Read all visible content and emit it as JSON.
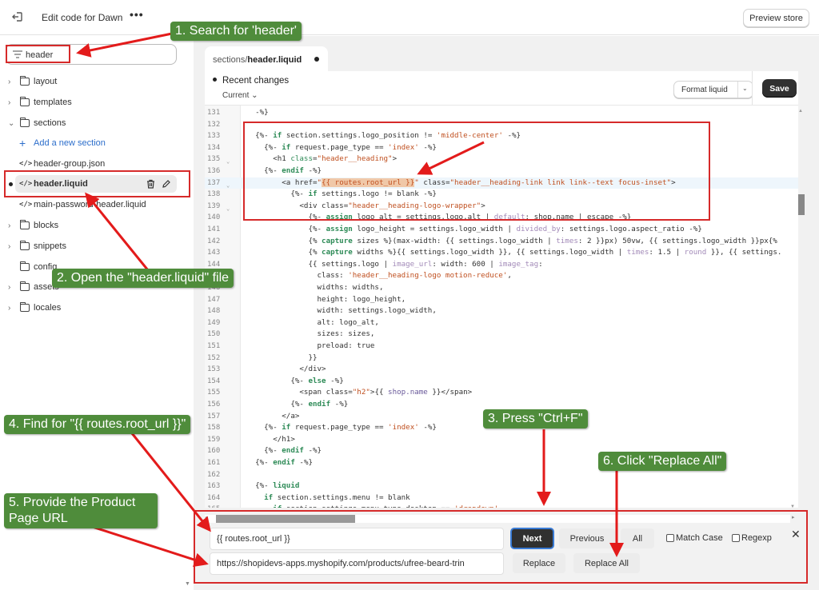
{
  "topbar": {
    "exit_icon": "exit-icon",
    "title": "Edit code for Dawn",
    "more_label": "•••",
    "preview_label": "Preview store"
  },
  "sidebar": {
    "search_value": "header",
    "search_icon": "filter-icon",
    "items": [
      {
        "type": "folder",
        "label": "layout",
        "expanded": false
      },
      {
        "type": "folder",
        "label": "templates",
        "expanded": false
      },
      {
        "type": "folder",
        "label": "sections",
        "expanded": true
      },
      {
        "type": "add",
        "label": "Add a new section"
      },
      {
        "type": "file",
        "label": "header-group.json"
      },
      {
        "type": "file",
        "label": "header.liquid",
        "active": true,
        "modified": true
      },
      {
        "type": "file",
        "label": "main-password-header.liquid"
      },
      {
        "type": "folder",
        "label": "blocks",
        "expanded": false
      },
      {
        "type": "folder",
        "label": "snippets",
        "expanded": false
      },
      {
        "type": "folder",
        "label": "config",
        "expanded": false
      },
      {
        "type": "folder",
        "label": "assets",
        "expanded": false
      },
      {
        "type": "folder",
        "label": "locales",
        "expanded": false
      }
    ]
  },
  "editor": {
    "tab_prefix": "sections/",
    "tab_file": "header.liquid",
    "recent_changes": "Recent changes",
    "current_label": "Current",
    "format_label": "Format liquid",
    "save_label": "Save",
    "lines": [
      {
        "n": "131",
        "html": "  -%}"
      },
      {
        "n": "132",
        "html": ""
      },
      {
        "n": "133",
        "html": "  <span class='p'>{%-</span> <span class='kw'>if</span> section.settings.logo_position != <span class='str'>'middle-center'</span> -%}"
      },
      {
        "n": "134",
        "html": "    {%- <span class='kw'>if</span> request.page_type == <span class='str'>'index'</span> -%}"
      },
      {
        "n": "135",
        "fold": true,
        "html": "      &lt;h1 <span class='kw2'>class</span>=<span class='str'>\"header__heading\"</span>&gt;"
      },
      {
        "n": "136",
        "html": "    {%- <span class='kw'>endif</span> -%}"
      },
      {
        "n": "137",
        "fold": true,
        "hl": true,
        "html": "        &lt;a href=<span class='str'>\"<span class='find-hl'>{{ routes.root_url }}</span>\"</span> class=<span class='str'>\"header__heading-link link link--text focus-inset\"</span>&gt;"
      },
      {
        "n": "138",
        "html": "          {%- <span class='kw'>if</span> settings.logo != blank -%}"
      },
      {
        "n": "139",
        "fold": true,
        "html": "            &lt;div class=<span class='str'>\"header__heading-logo-wrapper\"</span>&gt;"
      },
      {
        "n": "140",
        "html": "              {%- <span class='kw'>assign</span> logo_alt = settings.logo.alt | <span class='flt'>default</span>: shop.name | escape -%}"
      },
      {
        "n": "141",
        "html": "              {%- <span class='kw'>assign</span> logo_height = settings.logo_width | <span class='flt'>divided_by</span>: settings.logo.aspect_ratio -%}"
      },
      {
        "n": "142",
        "html": "              {% <span class='kw'>capture</span> sizes %}(max-width: {{ settings.logo_width | <span class='flt'>times</span>: 2 }}px) 50vw, {{ settings.logo_width }}px{%"
      },
      {
        "n": "143",
        "html": "              {% <span class='kw'>capture</span> widths %}{{ settings.logo_width }}, {{ settings.logo_width | <span class='flt'>times</span>: 1.5 | <span class='flt'>round</span> }}, {{ settings."
      },
      {
        "n": "144",
        "html": "              {{ settings.logo | <span class='flt'>image_url</span>: width: 600 | <span class='flt'>image_tag</span>:"
      },
      {
        "n": "145",
        "html": "                class: <span class='str'>'header__heading-logo motion-reduce'</span>,"
      },
      {
        "n": "146",
        "html": "                widths: widths,"
      },
      {
        "n": "147",
        "html": "                height: logo_height,"
      },
      {
        "n": "148",
        "html": "                width: settings.logo_width,"
      },
      {
        "n": "149",
        "html": "                alt: logo_alt,"
      },
      {
        "n": "150",
        "html": "                sizes: sizes,"
      },
      {
        "n": "151",
        "html": "                preload: true"
      },
      {
        "n": "152",
        "html": "              }}"
      },
      {
        "n": "153",
        "html": "            &lt;/div&gt;"
      },
      {
        "n": "154",
        "html": "          {%- <span class='kw'>else</span> -%}"
      },
      {
        "n": "155",
        "html": "            &lt;span class=<span class='str'>\"h2\"</span>&gt;{{ <span class='flt2'>shop.name</span> }}&lt;/span&gt;"
      },
      {
        "n": "156",
        "html": "          {%- <span class='kw'>endif</span> -%}"
      },
      {
        "n": "157",
        "html": "        &lt;/a&gt;"
      },
      {
        "n": "158",
        "html": "    {%- <span class='kw'>if</span> request.page_type == <span class='str'>'index'</span> -%}"
      },
      {
        "n": "159",
        "html": "      &lt;/h1&gt;"
      },
      {
        "n": "160",
        "html": "    {%- <span class='kw'>endif</span> -%}"
      },
      {
        "n": "161",
        "html": "  {%- <span class='kw'>endif</span> -%}"
      },
      {
        "n": "162",
        "html": ""
      },
      {
        "n": "163",
        "html": "  {%- <span class='kw'>liquid</span>"
      },
      {
        "n": "164",
        "html": "    <span class='kw'>if</span> section.settings.menu != blank"
      },
      {
        "n": "165",
        "html": "      <span class='kw'>if</span> section.settings.menu_type_desktop == <span class='str'>'dropdown'</span>"
      }
    ]
  },
  "findbar": {
    "find_value": "{{ routes.root_url }}",
    "replace_value": "https://shopidevs-apps.myshopify.com/products/ufree-beard-trin",
    "next_label": "Next",
    "previous_label": "Previous",
    "all_label": "All",
    "match_case_label": "Match Case",
    "regexp_label": "Regexp",
    "replace_label": "Replace",
    "replace_all_label": "Replace All",
    "close_label": "✕"
  },
  "annotations": {
    "step1": "1. Search for 'header'",
    "step2": "2. Open the \"header.liquid\" file",
    "step3": "3. Press \"Ctrl+F\"",
    "step4": "4. Find for \"{{ routes.root_url }}\"",
    "step5": "5. Provide the Product Page URL",
    "step6": "6. Click \"Replace All\"",
    "box_color": "#d62a2a",
    "tag_color": "#4f8c3b"
  }
}
